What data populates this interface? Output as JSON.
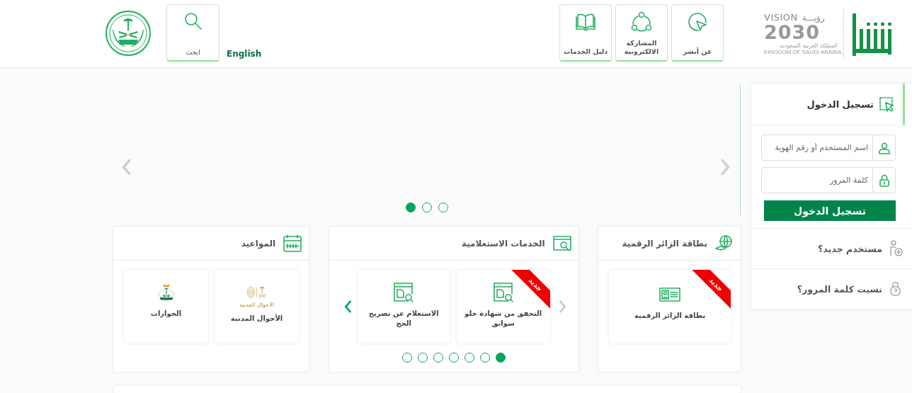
{
  "header": {
    "vision_logo": {
      "word": "VISION",
      "arabic_word": "رؤيـــة",
      "year": "2030",
      "country_ar": "المملكة العربية السعودية",
      "country_en": "KINGDOM OF SAUDI ARABIA"
    },
    "nav": [
      {
        "label": "عن أبشر"
      },
      {
        "label": "المشاركة الالكترونية"
      },
      {
        "label": "دليل الخدمات"
      }
    ],
    "language_link": "English",
    "search_button": "ابحث"
  },
  "slider": {
    "dots": [
      {
        "selected": true
      },
      {
        "selected": false
      },
      {
        "selected": false
      }
    ]
  },
  "login": {
    "title": "تسجيل الدخول",
    "username_placeholder": "اسم المستخدم أو رقم الهوية",
    "password_placeholder": "كلمة المرور",
    "submit": "تسجيل الدخول",
    "links": [
      {
        "label": "مستخدم جديد؟"
      },
      {
        "label": "نسيت كلمة المرور؟"
      }
    ]
  },
  "sections": [
    {
      "title": "بطاقة الزائر الرقمية",
      "tiles": [
        {
          "label": "بطاقة الزائر الرقمية",
          "badge": "جديد"
        }
      ]
    },
    {
      "title": "الخدمات الاستعلامية",
      "tiles": [
        {
          "label": "التحقق من شهادة خلو سوابق",
          "badge": "جديد"
        },
        {
          "label": "الاستعلام عن تصريح الحج"
        }
      ],
      "arrows": [
        {
          "disabled": true
        },
        {
          "disabled": false
        }
      ],
      "dots": [
        {
          "selected": true
        },
        {
          "selected": false
        },
        {
          "selected": false
        },
        {
          "selected": false
        },
        {
          "selected": false
        },
        {
          "selected": false
        },
        {
          "selected": false
        }
      ]
    },
    {
      "title": "المواعيد",
      "tiles": [
        {
          "label": "الأحوال المدنية",
          "logo_caption": "الاحوال المدنية"
        },
        {
          "label": "الجوازات"
        }
      ]
    }
  ]
}
